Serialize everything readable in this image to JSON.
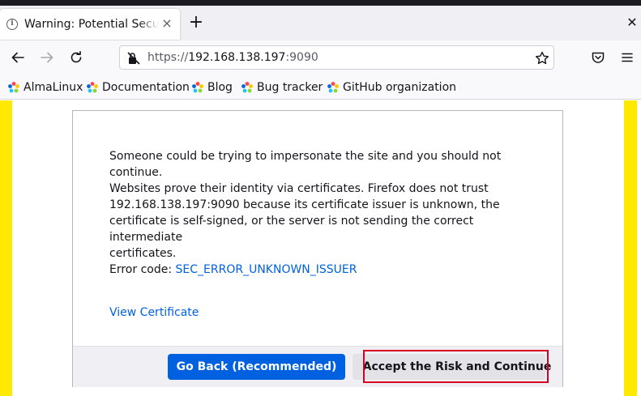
{
  "tab": {
    "title": "Warning: Potential Security Risk Ahead",
    "close_glyph": "×",
    "info_glyph": "i"
  },
  "tabstrip": {
    "new_tab_glyph": "+",
    "window_close_glyph": "✕"
  },
  "nav": {
    "back_icon": "back-arrow-icon",
    "forward_icon": "forward-arrow-icon",
    "reload_icon": "reload-icon",
    "url": {
      "protocol": "https://",
      "host": "192.168.138.197",
      "port": ":9090"
    },
    "star_icon": "star-icon",
    "pocket_icon": "pocket-icon",
    "menu_icon": "hamburger-menu-icon"
  },
  "bookmarks": [
    {
      "label": "AlmaLinux"
    },
    {
      "label": "Documentation"
    },
    {
      "label": "Blog"
    },
    {
      "label": "Bug tracker"
    },
    {
      "label": "GitHub organization"
    }
  ],
  "page": {
    "para1": "Someone could be trying to impersonate the site and you should not continue.",
    "para2_line1": "Websites prove their identity via certificates. Firefox does not trust",
    "para2_line2": "192.168.138.197:9090 because its certificate issuer is unknown, the",
    "para2_line3": "certificate is self-signed, or the server is not sending the correct intermediate",
    "para2_line4": "certificates.",
    "error_label": "Error code: ",
    "error_code": "SEC_ERROR_UNKNOWN_ISSUER",
    "view_certificate": "View Certificate",
    "go_back_label": "Go Back (Recommended)",
    "accept_label": "Accept the Risk and Continue"
  },
  "colors": {
    "stripe": "#ffe900",
    "primary_button": "#0061e0",
    "link": "#0061e0",
    "focus_outline": "#d70022"
  }
}
